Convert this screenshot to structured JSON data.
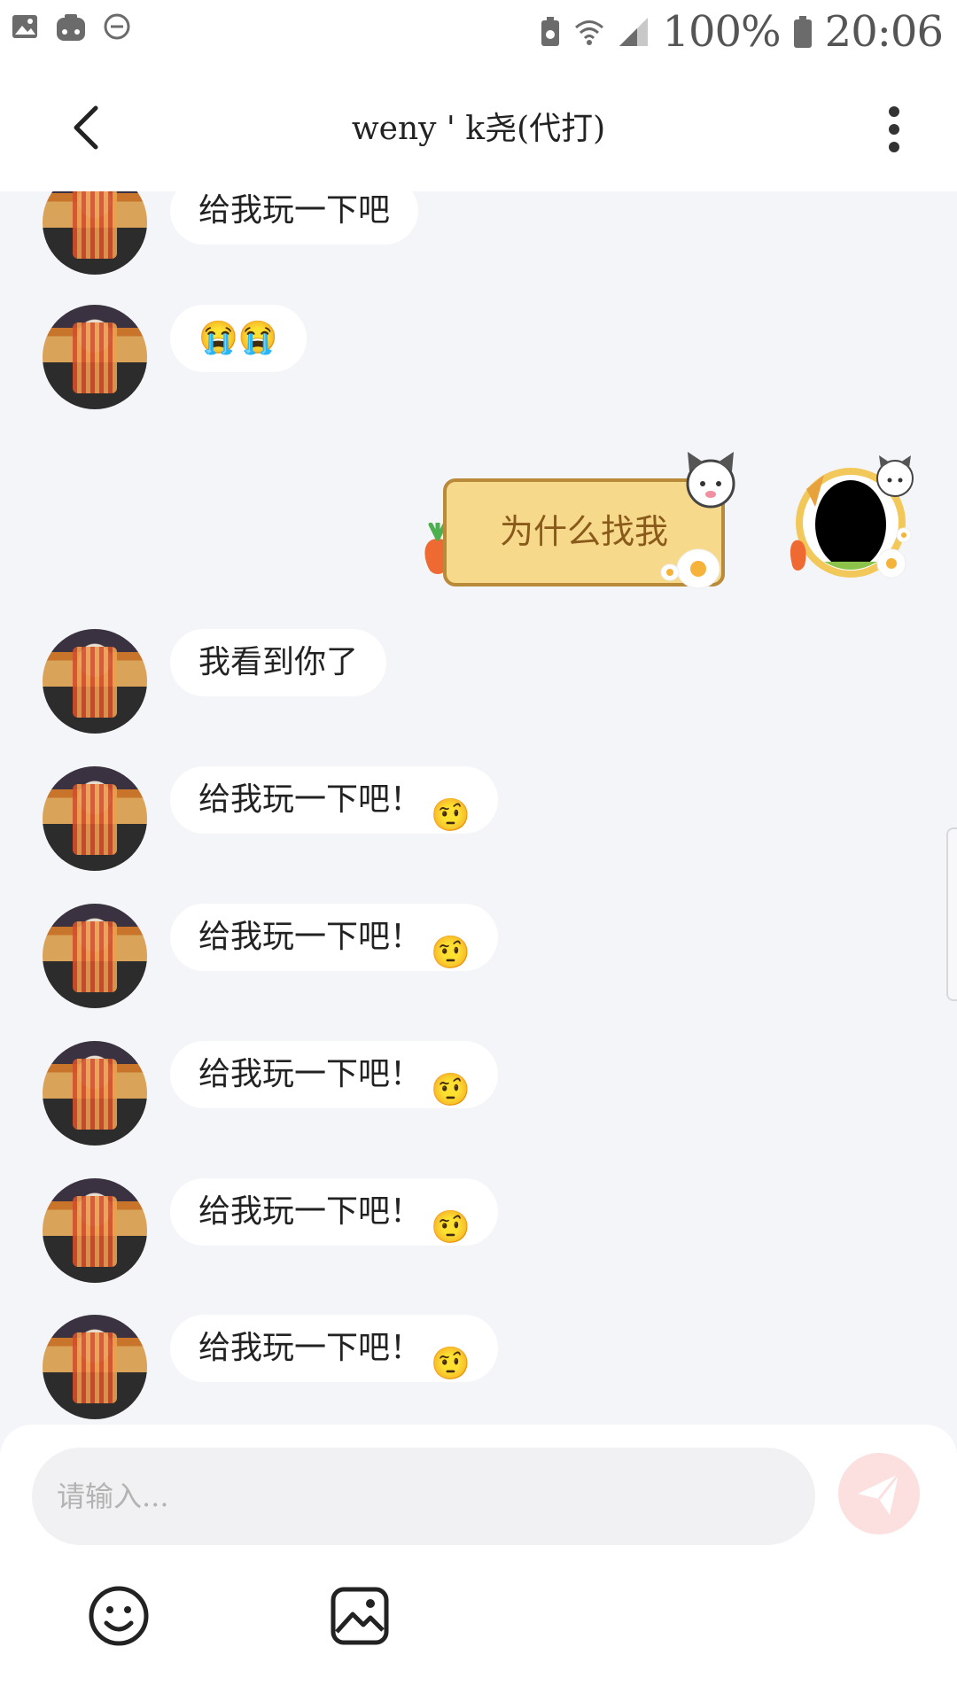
{
  "status_bar": {
    "battery": "100%",
    "time": "20:06",
    "icons": [
      "image-icon",
      "game-controller-icon",
      "do-not-disturb-icon",
      "battery-saver-icon",
      "wifi-icon",
      "signal-icon",
      "battery-icon"
    ]
  },
  "header": {
    "title": "weny ' k尧(代打)",
    "back_icon": "back-arrow-icon",
    "more_icon": "more-vertical-icon"
  },
  "messages": [
    {
      "sender": "other",
      "text": "给我玩一下吧",
      "emoji": ""
    },
    {
      "sender": "other",
      "text": "😭😭",
      "emoji": ""
    },
    {
      "sender": "me",
      "sticker_text": "为什么找我"
    },
    {
      "sender": "other",
      "text": "我看到你了",
      "emoji": ""
    },
    {
      "sender": "other",
      "text": "给我玩一下吧！",
      "emoji": "🤨"
    },
    {
      "sender": "other",
      "text": "给我玩一下吧！",
      "emoji": "🤨"
    },
    {
      "sender": "other",
      "text": "给我玩一下吧！",
      "emoji": "🤨"
    },
    {
      "sender": "other",
      "text": "给我玩一下吧！",
      "emoji": "🤨"
    },
    {
      "sender": "other",
      "text": "给我玩一下吧！",
      "emoji": "🤨"
    }
  ],
  "composer": {
    "placeholder": "请输入...",
    "send_icon": "send-icon",
    "emoji_icon": "emoji-icon",
    "image_icon": "image-icon"
  },
  "colors": {
    "chat_background": "#f4f5f8",
    "bubble": "#ffffff",
    "send_button": "#fbe0df",
    "sticker_card": "#f6d98a"
  }
}
